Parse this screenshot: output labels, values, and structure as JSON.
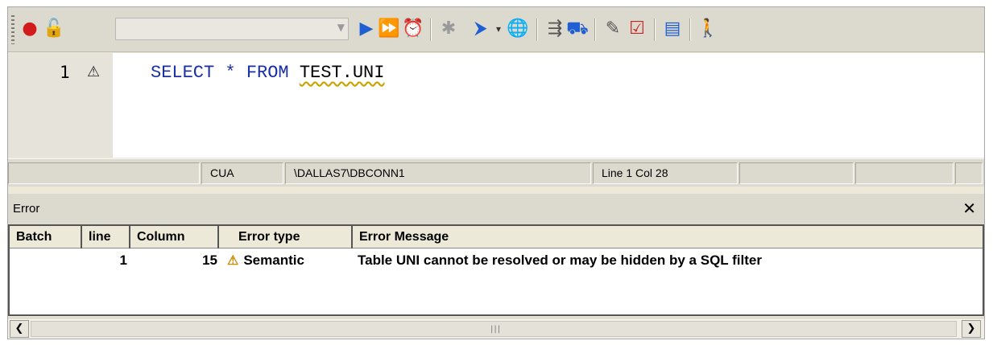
{
  "toolbar": {
    "icons": [
      "database-icon",
      "lock-icon",
      "run-icon",
      "run-all-icon",
      "schedule-icon",
      "debug-icon",
      "step-icon",
      "globe-icon",
      "explain-icon",
      "deploy-icon",
      "edit-icon",
      "validate-icon",
      "window-icon",
      "exit-icon"
    ],
    "combo_value": ""
  },
  "editor": {
    "line_number": "1",
    "code": {
      "kw1": "SELECT",
      "star": "*",
      "kw2": "FROM",
      "ident": "TEST.UNI"
    }
  },
  "status": {
    "mode": "CUA",
    "connection": "\\DALLAS7\\DBCONN1",
    "position": "Line 1 Col 28"
  },
  "error_panel": {
    "title": "Error",
    "columns": [
      "Batch",
      "line",
      "Column",
      "Error type",
      "Error Message"
    ],
    "rows": [
      {
        "batch": "",
        "line": "1",
        "column": "15",
        "type": "Semantic",
        "message": "Table UNI  cannot be resolved or may be hidden by a SQL filter"
      }
    ]
  },
  "colors": {
    "keyword": "#1a2fa8",
    "warning": "#d08a00",
    "chrome": "#dcd9cf"
  }
}
